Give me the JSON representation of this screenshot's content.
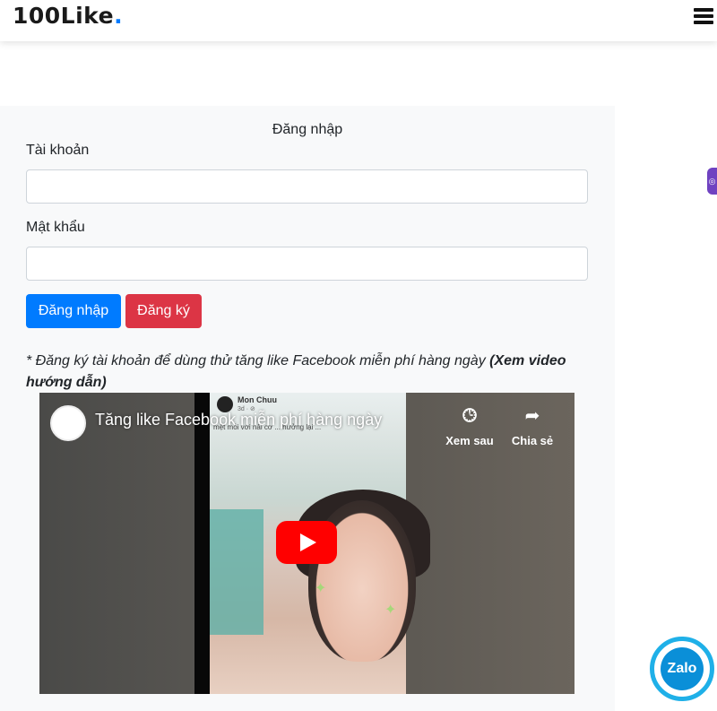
{
  "header": {
    "brand": "100Like",
    "brand_dot": "."
  },
  "login": {
    "title": "Đăng nhập",
    "username_label": "Tài khoản",
    "username_value": "",
    "password_label": "Mật khẩu",
    "password_value": "",
    "login_button": "Đăng nhập",
    "register_button": "Đăng ký"
  },
  "note": {
    "text": "* Đăng ký tài khoản để dùng thử tăng like Facebook miễn phí hàng ngày ",
    "link": "(Xem video hướng dẫn)"
  },
  "video": {
    "title": "Tăng like Facebook miễn phí hàng ngày",
    "watch_later": "Xem sau",
    "share": "Chia sẻ",
    "poster_name": "Mon Chuu",
    "poster_meta": "3d · ⊘",
    "poster_caption": "mệt mỏi với nải cơ ... hưởng lại ..."
  },
  "widgets": {
    "zalo": "Zalo"
  },
  "colors": {
    "primary": "#007bff",
    "danger": "#dc3545",
    "youtube": "#ff0000",
    "zalo": "#1fb0e8"
  }
}
